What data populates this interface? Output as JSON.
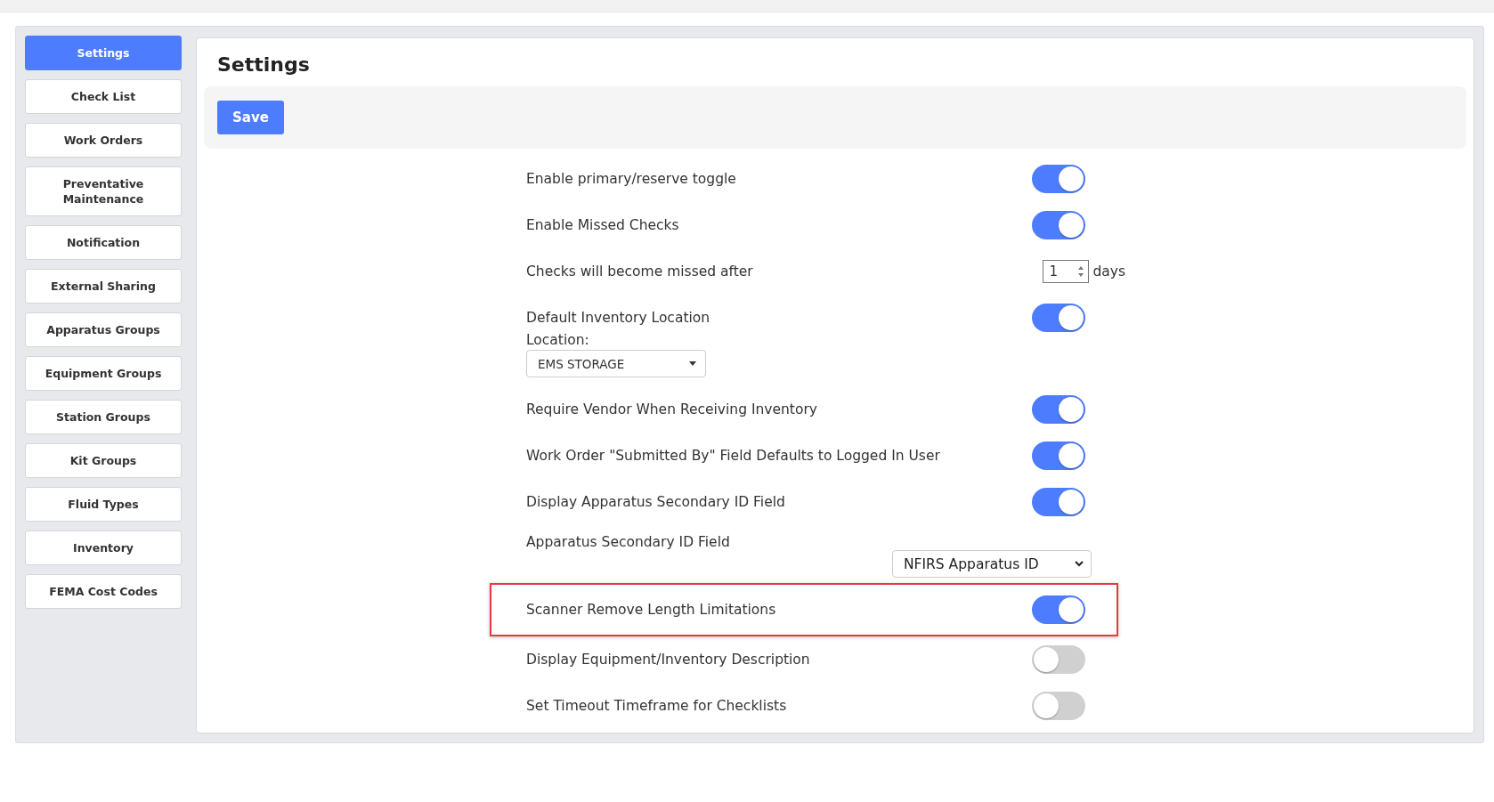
{
  "sidebar": {
    "items": [
      {
        "label": "Settings",
        "selected": true
      },
      {
        "label": "Check List",
        "selected": false
      },
      {
        "label": "Work Orders",
        "selected": false
      },
      {
        "label": "Preventative Maintenance",
        "selected": false
      },
      {
        "label": "Notification",
        "selected": false
      },
      {
        "label": "External Sharing",
        "selected": false
      },
      {
        "label": "Apparatus Groups",
        "selected": false
      },
      {
        "label": "Equipment Groups",
        "selected": false
      },
      {
        "label": "Station Groups",
        "selected": false
      },
      {
        "label": "Kit Groups",
        "selected": false
      },
      {
        "label": "Fluid Types",
        "selected": false
      },
      {
        "label": "Inventory",
        "selected": false
      },
      {
        "label": "FEMA Cost Codes",
        "selected": false
      }
    ]
  },
  "main": {
    "title": "Settings",
    "save_button": "Save",
    "rows": [
      {
        "kind": "toggle",
        "label": "Enable primary/reserve toggle",
        "on": true,
        "highlighted": false
      },
      {
        "kind": "toggle",
        "label": "Enable Missed Checks",
        "on": true,
        "highlighted": false
      },
      {
        "kind": "number",
        "label": "Checks will become missed after",
        "value": "1",
        "unit": "days",
        "highlighted": false
      },
      {
        "kind": "toggle",
        "label": "Default Inventory Location",
        "on": true,
        "highlighted": false
      },
      {
        "kind": "dropdown",
        "label": "Location:",
        "value": "EMS STORAGE",
        "highlighted": false
      },
      {
        "kind": "toggle",
        "label": "Require Vendor When Receiving Inventory",
        "on": true,
        "highlighted": false
      },
      {
        "kind": "toggle",
        "label": "Work Order \"Submitted By\" Field Defaults to Logged In User",
        "on": true,
        "highlighted": false
      },
      {
        "kind": "toggle",
        "label": "Display Apparatus Secondary ID Field",
        "on": true,
        "highlighted": false
      },
      {
        "kind": "select",
        "label": "Apparatus Secondary ID Field",
        "value": "NFIRS Apparatus ID",
        "highlighted": false
      },
      {
        "kind": "toggle",
        "label": "Scanner Remove Length Limitations",
        "on": true,
        "highlighted": true
      },
      {
        "kind": "toggle",
        "label": "Display Equipment/Inventory Description",
        "on": false,
        "highlighted": false
      },
      {
        "kind": "toggle",
        "label": "Set Timeout Timeframe for Checklists",
        "on": false,
        "highlighted": false
      }
    ]
  }
}
